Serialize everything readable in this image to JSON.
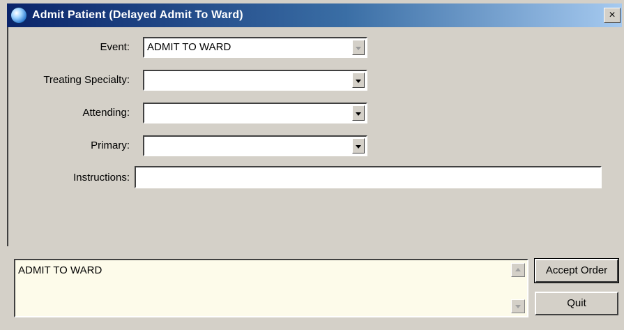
{
  "window": {
    "title": "Admit Patient (Delayed Admit To Ward)",
    "close_glyph": "×"
  },
  "form": {
    "event": {
      "label": "Event:",
      "value": "ADMIT TO WARD"
    },
    "treating_specialty": {
      "label": "Treating Specialty:",
      "value": ""
    },
    "attending": {
      "label": "Attending:",
      "value": ""
    },
    "primary": {
      "label": "Primary:",
      "value": ""
    },
    "instructions": {
      "label": "Instructions:",
      "value": ""
    }
  },
  "order": {
    "text": "ADMIT TO WARD"
  },
  "buttons": {
    "accept": "Accept Order",
    "quit": "Quit"
  },
  "icons": {
    "title": "globe-app-icon",
    "dropdown": "chevron-down-icon",
    "scroll_up": "scroll-up-arrow-icon",
    "scroll_down": "scroll-down-arrow-icon"
  },
  "colors": {
    "titlebar_start": "#0a246a",
    "titlebar_end": "#a6caf0",
    "face": "#d4d0c8",
    "order_background": "#fdfbea"
  }
}
